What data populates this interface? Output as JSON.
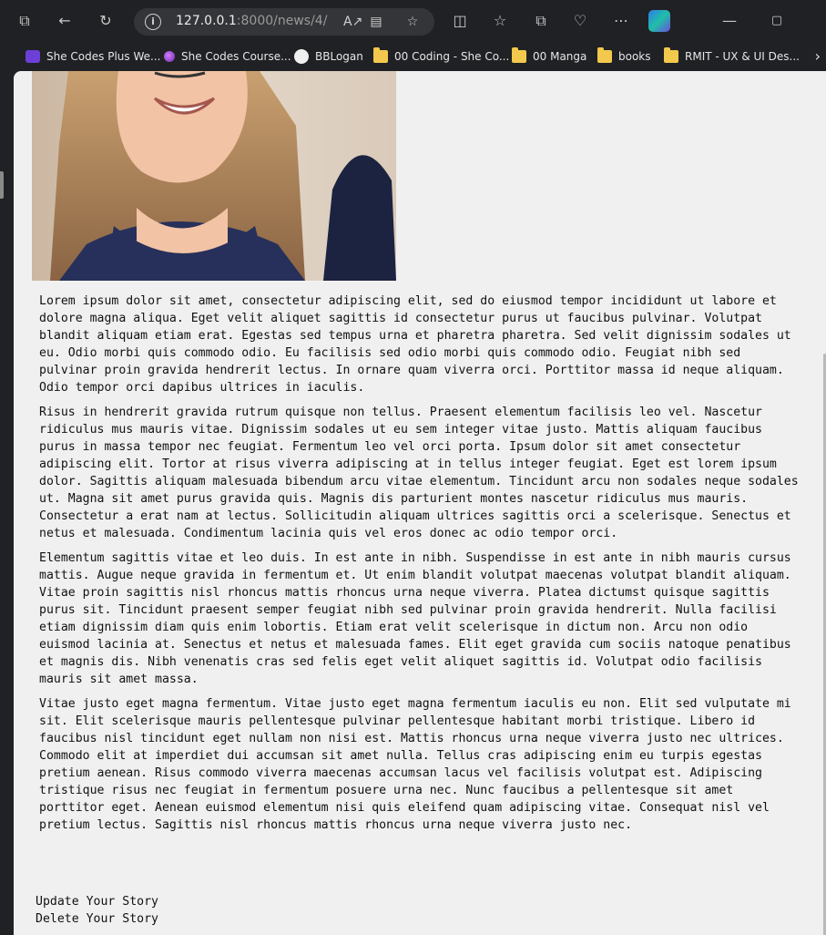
{
  "browser": {
    "url_host": "127.0.0.1",
    "url_path": ":8000/news/4/",
    "bookmarks": [
      {
        "label": "She Codes Plus We...",
        "icon": "she-codes-icon"
      },
      {
        "label": "She Codes Course...",
        "icon": "orb-icon"
      },
      {
        "label": "BBLogan",
        "icon": "github-icon"
      },
      {
        "label": "00 Coding - She Co...",
        "icon": "folder-icon"
      },
      {
        "label": "00 Manga",
        "icon": "folder-icon"
      },
      {
        "label": "books",
        "icon": "folder-icon"
      },
      {
        "label": "RMIT - UX & UI Des...",
        "icon": "folder-icon"
      }
    ]
  },
  "story": {
    "paragraphs": [
      "Lorem ipsum dolor sit amet, consectetur adipiscing elit, sed do eiusmod tempor incididunt ut labore et dolore magna aliqua. Eget velit aliquet sagittis id consectetur purus ut faucibus pulvinar. Volutpat blandit aliquam etiam erat. Egestas sed tempus urna et pharetra pharetra. Sed velit dignissim sodales ut eu. Odio morbi quis commodo odio. Eu facilisis sed odio morbi quis commodo odio. Feugiat nibh sed pulvinar proin gravida hendrerit lectus. In ornare quam viverra orci. Porttitor massa id neque aliquam. Odio tempor orci dapibus ultrices in iaculis.",
      "Risus in hendrerit gravida rutrum quisque non tellus. Praesent elementum facilisis leo vel. Nascetur ridiculus mus mauris vitae. Dignissim sodales ut eu sem integer vitae justo. Mattis aliquam faucibus purus in massa tempor nec feugiat. Fermentum leo vel orci porta. Ipsum dolor sit amet consectetur adipiscing elit. Tortor at risus viverra adipiscing at in tellus integer feugiat. Eget est lorem ipsum dolor. Sagittis aliquam malesuada bibendum arcu vitae elementum. Tincidunt arcu non sodales neque sodales ut. Magna sit amet purus gravida quis. Magnis dis parturient montes nascetur ridiculus mus mauris. Consectetur a erat nam at lectus. Sollicitudin aliquam ultrices sagittis orci a scelerisque. Senectus et netus et malesuada. Condimentum lacinia quis vel eros donec ac odio tempor orci.",
      "Elementum sagittis vitae et leo duis. In est ante in nibh. Suspendisse in est ante in nibh mauris cursus mattis. Augue neque gravida in fermentum et. Ut enim blandit volutpat maecenas volutpat blandit aliquam. Vitae proin sagittis nisl rhoncus mattis rhoncus urna neque viverra. Platea dictumst quisque sagittis purus sit. Tincidunt praesent semper feugiat nibh sed pulvinar proin gravida hendrerit. Nulla facilisi etiam dignissim diam quis enim lobortis. Etiam erat velit scelerisque in dictum non. Arcu non odio euismod lacinia at. Senectus et netus et malesuada fames. Elit eget gravida cum sociis natoque penatibus et magnis dis. Nibh venenatis cras sed felis eget velit aliquet sagittis id. Volutpat odio facilisis mauris sit amet massa.",
      "Vitae justo eget magna fermentum. Vitae justo eget magna fermentum iaculis eu non. Elit sed vulputate mi sit. Elit scelerisque mauris pellentesque pulvinar pellentesque habitant morbi tristique. Libero id faucibus nisl tincidunt eget nullam non nisi est. Mattis rhoncus urna neque viverra justo nec ultrices. Commodo elit at imperdiet dui accumsan sit amet nulla. Tellus cras adipiscing enim eu turpis egestas pretium aenean. Risus commodo viverra maecenas accumsan lacus vel facilisis volutpat est. Adipiscing tristique risus nec feugiat in fermentum posuere urna nec. Nunc faucibus a pellentesque sit amet porttitor eget. Aenean euismod elementum nisi quis eleifend quam adipiscing vitae. Consequat nisl vel pretium lectus. Sagittis nisl rhoncus mattis rhoncus urna neque viverra justo nec."
    ]
  },
  "actions": {
    "update_label": "Update Your Story",
    "delete_label": "Delete Your Story"
  }
}
